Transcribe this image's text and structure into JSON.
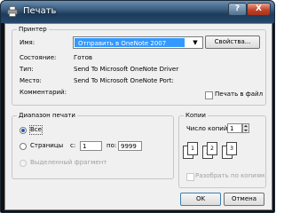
{
  "window": {
    "title": "Печать",
    "help_label": "?",
    "close_label": "X"
  },
  "printer": {
    "group_label": "Принтер",
    "name_label": "Имя:",
    "name_value": "Отправить в OneNote 2007",
    "combo_arrow": "▼",
    "properties_label": "Свойства...",
    "status_label": "Состояние:",
    "status_value": "Готов",
    "type_label": "Тип:",
    "type_value": "Send To Microsoft OneNote Driver",
    "where_label": "Место:",
    "where_value": "Send To Microsoft OneNote Port:",
    "comment_label": "Комментарий:",
    "print_to_file_label": "Печать в файл"
  },
  "range": {
    "group_label": "Диапазон печати",
    "all_label": "Все",
    "pages_label": "Страницы",
    "from_label": "с:",
    "from_value": "1",
    "to_label": "по:",
    "to_value": "9999",
    "selection_label": "Выделенный фрагмент"
  },
  "copies": {
    "group_label": "Копии",
    "count_label": "Число копий:",
    "count_value": "1",
    "collate_label": "Разобрать по копиям",
    "page_numbers": [
      "1",
      "1",
      "2",
      "2",
      "3",
      "3"
    ]
  },
  "buttons": {
    "ok_label": "OK",
    "cancel_label": "Отмена"
  }
}
